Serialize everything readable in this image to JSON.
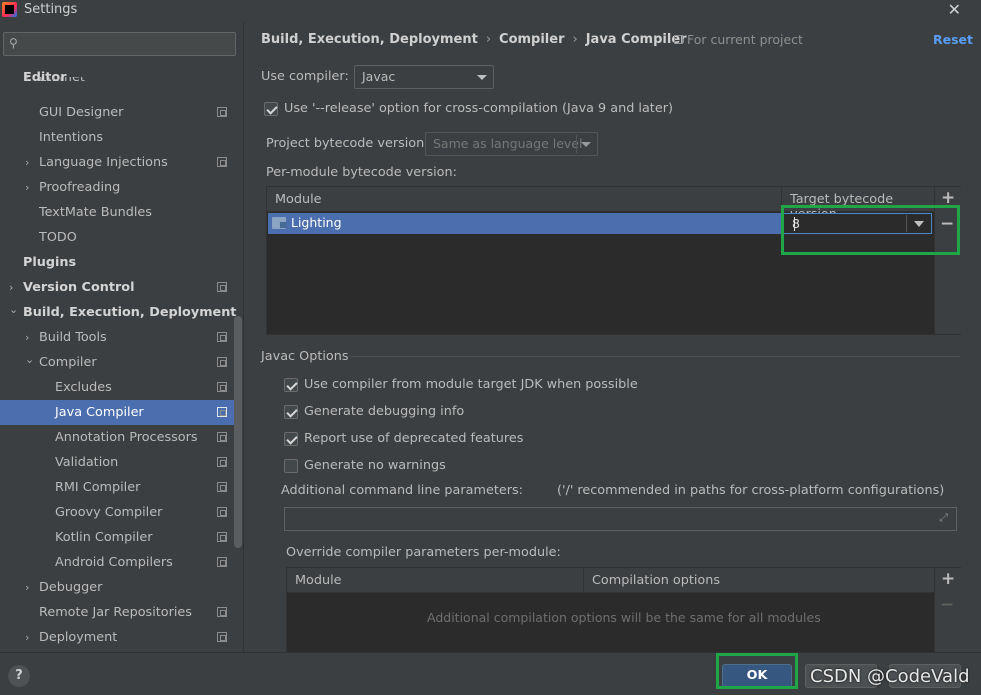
{
  "window": {
    "title": "Settings",
    "close_glyph": "✕"
  },
  "sidebar": {
    "search_icon": "⚲",
    "items": [
      {
        "label": "Editor",
        "bold": true
      },
      {
        "label": "Emmet"
      },
      {
        "label": "GUI Designer"
      },
      {
        "label": "Intentions"
      },
      {
        "label": "Language Injections"
      },
      {
        "label": "Proofreading"
      },
      {
        "label": "TextMate Bundles"
      },
      {
        "label": "TODO"
      },
      {
        "label": "Plugins",
        "bold": true
      },
      {
        "label": "Version Control",
        "bold": true
      },
      {
        "label": "Build, Execution, Deployment",
        "bold": true
      },
      {
        "label": "Build Tools"
      },
      {
        "label": "Compiler"
      },
      {
        "label": "Excludes"
      },
      {
        "label": "Java Compiler",
        "selected": true
      },
      {
        "label": "Annotation Processors"
      },
      {
        "label": "Validation"
      },
      {
        "label": "RMI Compiler"
      },
      {
        "label": "Groovy Compiler"
      },
      {
        "label": "Kotlin Compiler"
      },
      {
        "label": "Android Compilers"
      },
      {
        "label": "Debugger"
      },
      {
        "label": "Remote Jar Repositories"
      },
      {
        "label": "Deployment"
      }
    ],
    "arrow_collapsed": "›",
    "arrow_expanded": "⌄"
  },
  "breadcrumb": {
    "part1": "Build, Execution, Deployment",
    "part2": "Compiler",
    "part3": "Java Compiler",
    "sep": "›",
    "scope": "For current project",
    "reset": "Reset"
  },
  "compiler": {
    "use_compiler_label": "Use compiler:",
    "use_compiler_value": "Javac",
    "release_option_label": "Use '--release' option for cross-compilation (Java 9 and later)",
    "release_option_checked": true,
    "bytecode_label": "Project bytecode version:",
    "bytecode_value": "Same as language level",
    "per_module_label": "Per-module bytecode version:",
    "module_table": {
      "col_module": "Module",
      "col_target": "Target bytecode version",
      "rows": [
        {
          "module": "Lighting",
          "target": "8"
        }
      ],
      "add": "+",
      "remove": "−"
    }
  },
  "javac": {
    "section_title": "Javac Options",
    "options": [
      {
        "label": "Use compiler from module target JDK when possible",
        "checked": true
      },
      {
        "label": "Generate debugging info",
        "checked": true
      },
      {
        "label": "Report use of deprecated features",
        "checked": true
      },
      {
        "label": "Generate no warnings",
        "checked": false
      }
    ],
    "cmd_label": "Additional command line parameters:",
    "cmd_hint": "('/' recommended in paths for cross-platform configurations)",
    "cmd_value": "",
    "override_label": "Override compiler parameters per-module:",
    "override_table": {
      "col_module": "Module",
      "col_options": "Compilation options",
      "empty_text": "Additional compilation options will be the same for all modules",
      "add": "+",
      "remove": "−"
    }
  },
  "footer": {
    "help": "?",
    "ok": "OK",
    "watermark": "CSDN @CodeVald"
  },
  "colors": {
    "selection": "#4b6eaf",
    "highlight_box": "#1fa646",
    "link": "#589df6"
  }
}
